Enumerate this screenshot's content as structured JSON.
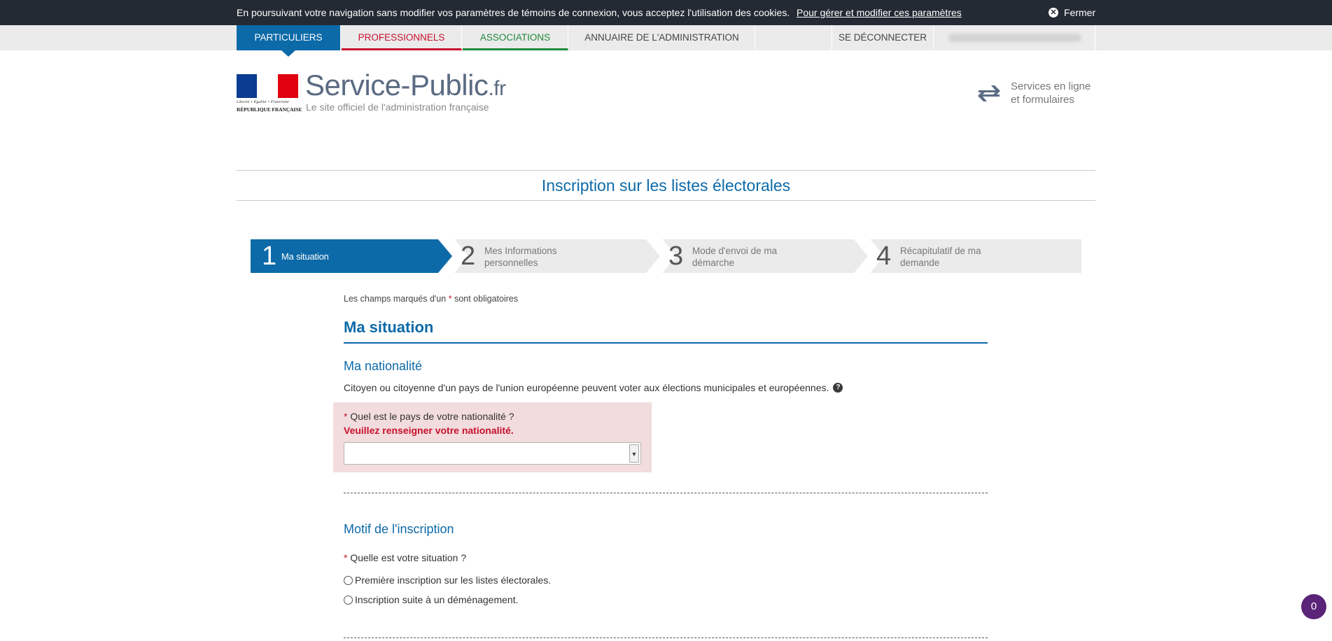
{
  "cookie_bar": {
    "text": "En poursuivant votre navigation sans modifier vos paramètres de témoins de connexion, vous acceptez l'utilisation des cookies.",
    "link": "Pour gérer et modifier ces paramètres",
    "close": "Fermer"
  },
  "nav": {
    "particuliers": "PARTICULIERS",
    "professionnels": "PROFESSIONNELS",
    "associations": "ASSOCIATIONS",
    "annuaire": "ANNUAIRE DE L'ADMINISTRATION",
    "deconnecter": "SE DÉCONNECTER"
  },
  "header": {
    "logo_motto": "Liberté • Égalité • Fraternité",
    "logo_republic": "RÉPUBLIQUE FRANÇAISE",
    "site_name": "Service-Public",
    "site_tld": ".fr",
    "site_tagline": "Le site officiel de l'administration française",
    "services_line1": "Services en ligne",
    "services_line2": "et formulaires"
  },
  "page_title": "Inscription sur les listes électorales",
  "steps": [
    {
      "num": "1",
      "label": "Ma situation"
    },
    {
      "num": "2",
      "label1": "Mes Informations",
      "label2": "personnelles"
    },
    {
      "num": "3",
      "label1": "Mode d'envoi de ma",
      "label2": "démarche"
    },
    {
      "num": "4",
      "label1": "Récapitulatif de ma",
      "label2": "demande"
    }
  ],
  "form": {
    "required_prefix": "Les champs marqués d'un",
    "required_star": "*",
    "required_suffix": "sont obligatoires",
    "section_title": "Ma situation",
    "nationality_title": "Ma nationalité",
    "nationality_info": "Citoyen ou citoyenne d'un pays de l'union européenne peuvent voter aux élections municipales et européennes.",
    "nationality_question": "Quel est le pays de votre nationalité ?",
    "nationality_error": "Veuillez renseigner votre nationalité.",
    "nationality_value": "",
    "motif_title": "Motif de l'inscription",
    "motif_question": "Quelle est votre situation ?",
    "motif_options": [
      "Première inscription sur les listes électorales.",
      "Inscription suite à un déménagement."
    ]
  },
  "help_glyph": "?",
  "counter": "0",
  "colors": {
    "brand_blue": "#0d6aa8",
    "error_red": "#c8102e",
    "association_green": "#208a3c",
    "dark_bar": "#242a33"
  }
}
